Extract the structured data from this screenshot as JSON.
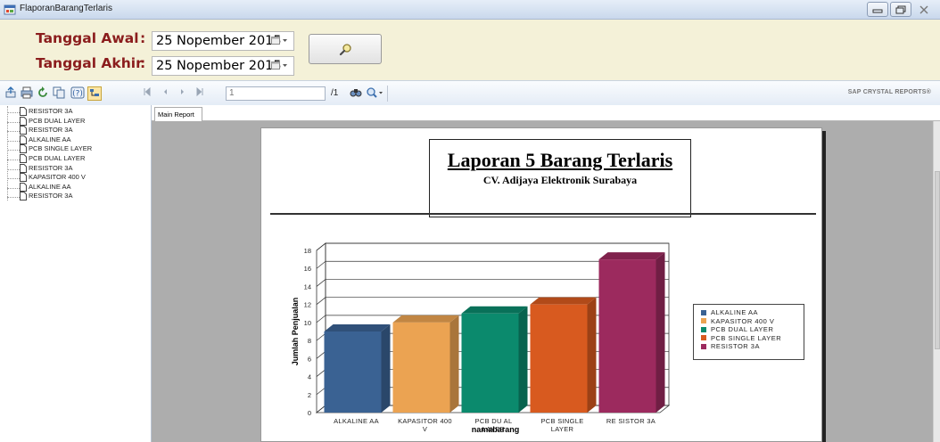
{
  "window": {
    "title": "FlaporanBarangTerlaris"
  },
  "params": {
    "start_label": "Tanggal Awal",
    "end_label": "Tanggal Akhir",
    "colon": ":",
    "start_value": "25 Nopember 2015",
    "end_value": "25 Nopember 2015"
  },
  "toolbar": {
    "page_value": "1",
    "page_count": "/1",
    "brand": "SAP CRYSTAL REPORTS®"
  },
  "tree": {
    "items": [
      "RESISTOR 3A",
      "PCB DUAL LAYER",
      "RESISTOR 3A",
      "ALKALINE AA",
      "PCB SINGLE LAYER",
      "PCB DUAL LAYER",
      "RESISTOR 3A",
      "KAPASITOR 400 V",
      "ALKALINE AA",
      "RESISTOR 3A"
    ]
  },
  "report": {
    "tab": "Main Report",
    "title": "Laporan 5 Barang Terlaris",
    "subtitle": "CV. Adijaya Elektronik Surabaya"
  },
  "chart_data": {
    "type": "bar",
    "categories": [
      "ALKALINE AA",
      "KAPASITOR 400 V",
      "PCB DUAL LAYER",
      "PCB SINGLE LAYER",
      "RESISTOR 3A"
    ],
    "tick_labels": [
      [
        "ALKALINE AA"
      ],
      [
        "KAPASITOR 400",
        "V"
      ],
      [
        "PCB DU AL",
        "LAYER"
      ],
      [
        "PCB SINGLE",
        "LAYER"
      ],
      [
        "RE SISTOR 3A"
      ]
    ],
    "values": [
      9,
      10,
      11,
      12,
      17
    ],
    "colors": [
      "#3a6293",
      "#eba352",
      "#0b8a6d",
      "#d85a1f",
      "#9c2a5e"
    ],
    "legend": [
      "ALKALINE AA",
      "KAPASITOR 400 V",
      "PCB DUAL LAYER",
      "PCB SINGLE LAYER",
      "RESISTOR 3A"
    ],
    "xlabel": "namabarang",
    "ylabel": "Jumlah Penjualan",
    "ylim": [
      0,
      18
    ],
    "yticks": [
      0,
      2,
      4,
      6,
      8,
      10,
      12,
      14,
      16,
      18
    ],
    "grid": true,
    "legend_position": "right"
  }
}
